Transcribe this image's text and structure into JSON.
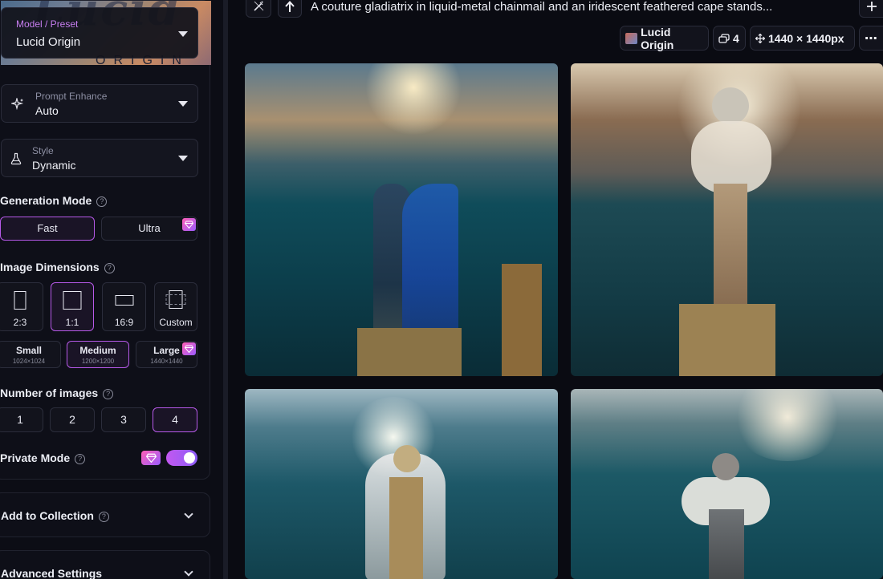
{
  "sidebar": {
    "model": {
      "label": "Model / Preset",
      "value": "Lucid Origin",
      "hero_text": "ORIGIN"
    },
    "prompt_enhance": {
      "label": "Prompt Enhance",
      "value": "Auto"
    },
    "style": {
      "label": "Style",
      "value": "Dynamic"
    },
    "generation_mode": {
      "title": "Generation Mode",
      "options": [
        "Fast",
        "Ultra"
      ],
      "selected": "Fast"
    },
    "image_dimensions": {
      "title": "Image Dimensions",
      "ratios": [
        "2:3",
        "1:1",
        "16:9",
        "Custom"
      ],
      "selected_ratio": "1:1",
      "sizes": [
        {
          "label": "Small",
          "dims": "1024×1024"
        },
        {
          "label": "Medium",
          "dims": "1200×1200"
        },
        {
          "label": "Large",
          "dims": "1440×1440"
        }
      ],
      "selected_size": "Medium"
    },
    "number_of_images": {
      "title": "Number of images",
      "options": [
        "1",
        "2",
        "3",
        "4"
      ],
      "selected": "4"
    },
    "private_mode": {
      "title": "Private Mode",
      "enabled": true
    },
    "add_to_collection": {
      "title": "Add to Collection"
    },
    "advanced_settings": {
      "title": "Advanced Settings"
    }
  },
  "main": {
    "prompt": "A couture gladiatrix in liquid-metal chainmail and an iridescent feathered cape stands...",
    "chips": {
      "model": "Lucid Origin",
      "count": "4",
      "dimensions": "1440 × 1440px"
    }
  },
  "colors": {
    "accent": "#b659e8",
    "background": "#0a0b12",
    "panel": "#0e0f18"
  }
}
